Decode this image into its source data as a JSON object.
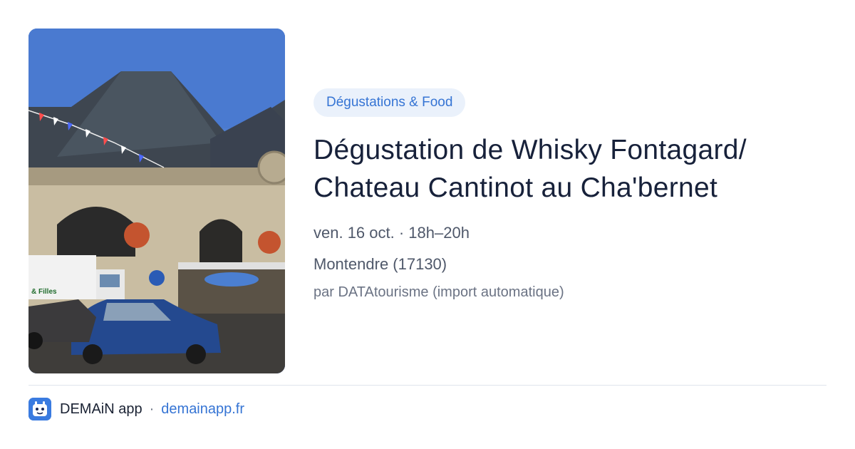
{
  "event": {
    "category": "Dégustations & Food",
    "title_line1": "Dégustation de Whisky Fontagard/",
    "title_line2": "Chateau Cantinot au Cha'bernet",
    "date": "ven. 16 oct. · 18h–20h",
    "location": "Montendre (17130)",
    "source": "par DATAtourisme (import automatique)",
    "image_sign_text": "& Filles"
  },
  "footer": {
    "app_name": "DEMAiN app",
    "separator": "·",
    "url": "demainapp.fr"
  },
  "colors": {
    "accent": "#3574d4",
    "badge_bg": "#eaf1fb",
    "title": "#17213a",
    "muted": "#4f586a"
  }
}
